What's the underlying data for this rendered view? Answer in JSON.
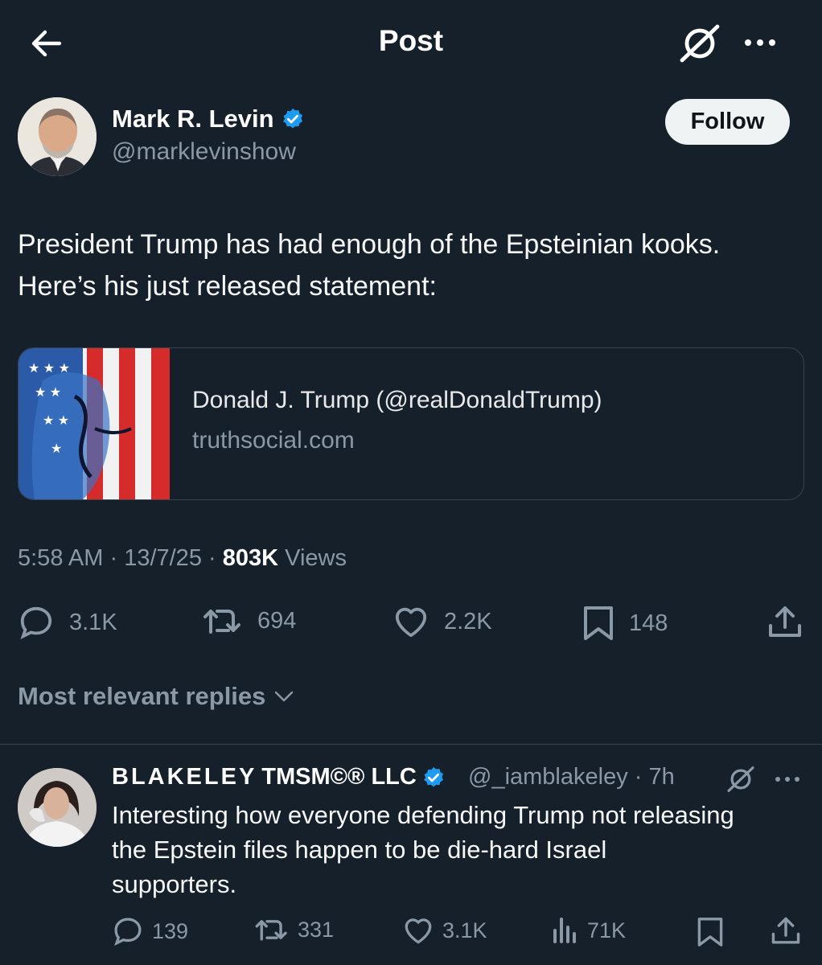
{
  "header": {
    "title": "Post"
  },
  "post": {
    "author_name": "Mark R. Levin",
    "author_handle": "@marklevinshow",
    "follow_label": "Follow",
    "text_line1": "President Trump has had enough of the Epsteinian kooks.",
    "text_line2": "Here’s his just released statement:",
    "card": {
      "title": "Donald J. Trump (@realDonaldTrump)",
      "domain": "truthsocial.com"
    },
    "time": "5:58 AM",
    "date": "13/7/25",
    "views_count": "803K",
    "views_label": "Views",
    "stats": {
      "replies": "3.1K",
      "reposts": "694",
      "likes": "2.2K",
      "bookmarks": "148"
    }
  },
  "replies_section": {
    "label": "Most relevant replies"
  },
  "reply": {
    "author_name_spaced": "BLAKELEY",
    "author_name_marks": "TMSM©® LLC",
    "author_handle": "@_iamblakeley",
    "age": "7h",
    "text_line1": "Interesting how everyone defending Trump not releasing",
    "text_line2": "the Epstein files happen to be die-hard Israel",
    "text_line3": "supporters.",
    "stats": {
      "replies": "139",
      "reposts": "331",
      "likes": "3.1K",
      "views": "71K"
    }
  },
  "colors": {
    "background": "#15202b",
    "verified": "#1d9bf0",
    "muted": "#8b98a5"
  }
}
